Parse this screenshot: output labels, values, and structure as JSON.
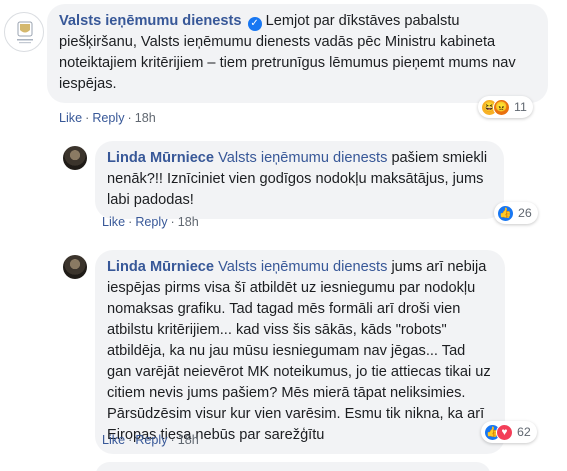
{
  "comments": [
    {
      "author": "Valsts ieņēmumu dienests",
      "text": "Lemjot par dīkstāves pabalstu piešķiršanu, Valsts ieņēmumu dienests vadās pēc Ministru kabineta noteiktajiem kritērijiem – tiem pretrunīgus lēmumus pieņemt mums nav iespējas.",
      "like_label": "Like",
      "reply_label": "Reply",
      "time": "18h",
      "reaction_count": "11",
      "reaction_icons": [
        "haha-icon",
        "angry-icon"
      ]
    },
    {
      "author": "Linda Mūrniece",
      "mention": "Valsts ieņēmumu dienests",
      "text": "pašiem smiekli nenāk?!! Iznīciniet vien godīgos nodokļu maksātājus, jums labi padodas!",
      "like_label": "Like",
      "reply_label": "Reply",
      "time": "18h",
      "reaction_count": "26",
      "reaction_icons": [
        "like-icon"
      ]
    },
    {
      "author": "Linda Mūrniece",
      "mention": "Valsts ieņēmumu dienests",
      "text": "jums arī nebija iespējas pirms visa šī atbildēt uz iesniegumu par nodokļu nomaksas grafiku. Tad tagad mēs formāli arī droši vien atbilstu kritērijiem... kad viss šis sākās, kāds \"robots\" atbildēja, ka nu jau mūsu iesniegumam nav jēgas... Tad gan varējāt neievērot MK noteikumus, jo tie attiecas tikai uz citiem nevis jums pašiem? Mēs mierā tāpat neliksimies. Pārsūdzēsim visur kur vien varēsim. Esmu tik nikna, ka arī Eiropas tiesa nebūs par sarežģītu",
      "like_label": "Like",
      "reply_label": "Reply",
      "time": "18h",
      "reaction_count": "62",
      "reaction_icons": [
        "like-icon",
        "love-icon"
      ]
    }
  ],
  "colors": {
    "link": "#385898",
    "bubble": "#f2f3f5",
    "like": "#1877f2",
    "love": "#f33e58",
    "haha": "#f7b125",
    "angry": "#e9710f"
  }
}
